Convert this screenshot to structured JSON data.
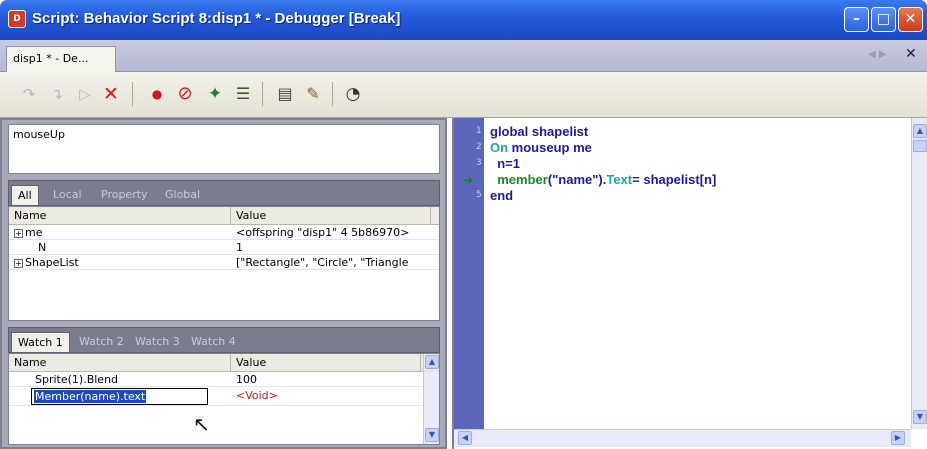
{
  "window": {
    "title": "Script: Behavior Script 8:disp1 * - Debugger [Break]",
    "icon_label": "D"
  },
  "doc_tab": {
    "label": "disp1 * - De..."
  },
  "toolbar": {
    "icons": [
      "step-over-icon",
      "step-into-icon",
      "run-icon",
      "stop-debugging-icon",
      "breakpoint-icon",
      "clear-breakpoints-icon",
      "watch-expression-icon",
      "call-stack-icon",
      "inspector-icon",
      "script-browse-icon",
      "help-icon"
    ]
  },
  "call_stack": {
    "items": [
      "mouseUp"
    ]
  },
  "variables": {
    "tabs": [
      "All",
      "Local",
      "Property",
      "Global"
    ],
    "columns": [
      "Name",
      "Value"
    ],
    "rows": [
      {
        "name": "me",
        "value": "<offspring \"disp1\" 4 5b86970>",
        "expandable": true
      },
      {
        "name": "N",
        "value": "1",
        "expandable": false
      },
      {
        "name": "ShapeList",
        "value": "[\"Rectangle\", \"Circle\", \"Triangle",
        "expandable": true
      }
    ]
  },
  "watch": {
    "tabs": [
      "Watch 1",
      "Watch 2",
      "Watch 3",
      "Watch 4"
    ],
    "columns": [
      "Name",
      "Value"
    ],
    "rows": [
      {
        "name": "Sprite(1).Blend",
        "value": "100"
      },
      {
        "name": "Member(name).text",
        "value": "<Void>"
      }
    ]
  },
  "script": {
    "lines": [
      {
        "num": "1",
        "parts": [
          [
            "kw1",
            "global shapelist"
          ]
        ]
      },
      {
        "num": "2",
        "parts": [
          [
            "kw2",
            "On "
          ],
          [
            "kw1",
            "mouseup me"
          ]
        ]
      },
      {
        "num": "3",
        "parts": [
          [
            "kw1",
            "  n=1"
          ]
        ]
      },
      {
        "num": "4",
        "parts": [
          [
            "fn",
            "  member"
          ],
          [
            "kw1",
            "(\"name\")."
          ],
          [
            "tx",
            "Text"
          ],
          [
            "kw1",
            "= shapelist[n]"
          ]
        ]
      },
      {
        "num": "5",
        "parts": [
          [
            "kw1",
            "end"
          ]
        ]
      }
    ],
    "current_line": 4
  },
  "colors": {
    "titlebar": "#2258d8",
    "gutter": "#5b66b8",
    "selection": "#1d4bbd"
  }
}
